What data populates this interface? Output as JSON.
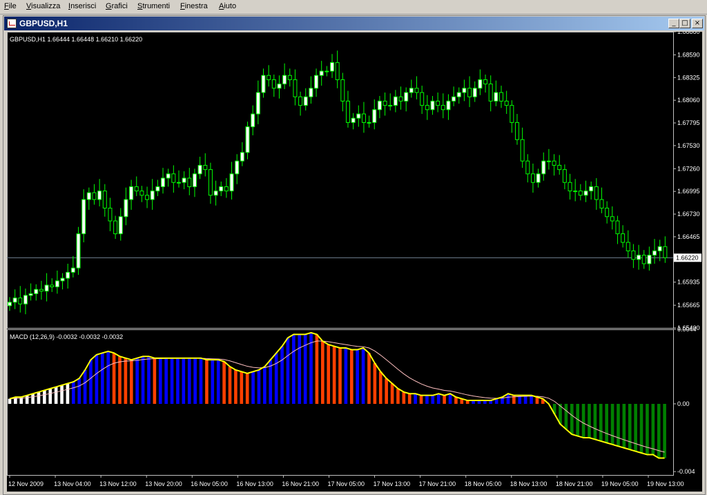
{
  "menu": [
    "File",
    "Visualizza",
    "Inserisci",
    "Grafici",
    "Strumenti",
    "Finestra",
    "Aiuto"
  ],
  "window": {
    "title": "GBPUSD,H1",
    "buttons": [
      "_",
      "□",
      "×"
    ]
  },
  "price_pane": {
    "label": "GBPUSD,H1  1.66444 1.66448 1.66210 1.66220",
    "price_ticks": [
      "1.68860",
      "1.68590",
      "1.68325",
      "1.68060",
      "1.67795",
      "1.67530",
      "1.67260",
      "1.66995",
      "1.66730",
      "1.66465",
      "1.66220",
      "1.65935",
      "1.65665",
      "1.65400"
    ],
    "current_price": "1.66220"
  },
  "macd_pane": {
    "label": "MACD (12,26,9) -0.0032 -0.0032 -0.0032",
    "ticks": [
      "0.0044",
      "0.00",
      "-0.004"
    ]
  },
  "time_ticks": [
    "12 Nov 2009",
    "13 Nov 04:00",
    "13 Nov 12:00",
    "13 Nov 20:00",
    "16 Nov 05:00",
    "16 Nov 13:00",
    "16 Nov 21:00",
    "17 Nov 05:00",
    "17 Nov 13:00",
    "17 Nov 21:00",
    "18 Nov 05:00",
    "18 Nov 13:00",
    "18 Nov 21:00",
    "19 Nov 05:00",
    "19 Nov 13:00"
  ],
  "colors": {
    "bull": "#ffffff",
    "bear": "#000000",
    "wick": "#00ff00",
    "grid": "#ffffff",
    "macd_up": "#0000ff",
    "macd_down": "#ff4000",
    "macd_neg_down": "#008000",
    "macd_line": "#ffff00",
    "signal_line": "#ffc0c0"
  },
  "chart_data": {
    "type": "candlestick",
    "symbol": "GBPUSD",
    "timeframe": "H1",
    "ylim": [
      1.654,
      1.6886
    ],
    "closes": [
      1.657,
      1.6575,
      1.6568,
      1.6578,
      1.658,
      1.6585,
      1.6583,
      1.659,
      1.6588,
      1.6595,
      1.6598,
      1.6605,
      1.661,
      1.665,
      1.669,
      1.6698,
      1.669,
      1.67,
      1.668,
      1.6665,
      1.665,
      1.667,
      1.669,
      1.6705,
      1.67,
      1.6695,
      1.669,
      1.67,
      1.6705,
      1.6715,
      1.672,
      1.671,
      1.671,
      1.6715,
      1.6705,
      1.672,
      1.673,
      1.6725,
      1.6695,
      1.67,
      1.6705,
      1.67,
      1.672,
      1.6735,
      1.6745,
      1.6775,
      1.679,
      1.6815,
      1.6835,
      1.683,
      1.682,
      1.6825,
      1.6835,
      1.683,
      1.681,
      1.68,
      1.681,
      1.682,
      1.6835,
      1.684,
      1.684,
      1.685,
      1.683,
      1.6805,
      1.678,
      1.6785,
      1.679,
      1.678,
      1.678,
      1.6795,
      1.6805,
      1.68,
      1.68,
      1.681,
      1.6805,
      1.6815,
      1.682,
      1.6815,
      1.68,
      1.6795,
      1.6805,
      1.68,
      1.6795,
      1.6805,
      1.681,
      1.6815,
      1.682,
      1.681,
      1.682,
      1.683,
      1.6825,
      1.6805,
      1.6815,
      1.6805,
      1.68,
      1.678,
      1.676,
      1.6735,
      1.672,
      1.671,
      1.672,
      1.6735,
      1.6735,
      1.673,
      1.6725,
      1.671,
      1.67,
      1.67,
      1.6695,
      1.67,
      1.6705,
      1.669,
      1.668,
      1.667,
      1.6665,
      1.665,
      1.664,
      1.663,
      1.662,
      1.6625,
      1.6615,
      1.6625,
      1.663,
      1.6635,
      1.6622
    ],
    "macd_hist": [
      0.0003,
      0.0004,
      0.0004,
      0.0005,
      0.0006,
      0.0007,
      0.0008,
      0.0009,
      0.001,
      0.0011,
      0.0012,
      0.0013,
      0.0015,
      0.002,
      0.0026,
      0.0029,
      0.003,
      0.0031,
      0.003,
      0.0028,
      0.0027,
      0.0026,
      0.0027,
      0.0028,
      0.0028,
      0.0027,
      0.0027,
      0.0027,
      0.0027,
      0.0027,
      0.0027,
      0.0027,
      0.0027,
      0.0027,
      0.0026,
      0.0026,
      0.0026,
      0.0025,
      0.0022,
      0.002,
      0.0019,
      0.0018,
      0.0019,
      0.002,
      0.0022,
      0.0026,
      0.003,
      0.0034,
      0.0039,
      0.0041,
      0.0041,
      0.0041,
      0.0042,
      0.0041,
      0.0037,
      0.0035,
      0.0034,
      0.0033,
      0.0033,
      0.0032,
      0.0032,
      0.0033,
      0.003,
      0.0024,
      0.0019,
      0.0015,
      0.0012,
      0.0009,
      0.0007,
      0.0006,
      0.0006,
      0.0005,
      0.0005,
      0.0005,
      0.0006,
      0.0005,
      0.0006,
      0.0004,
      0.0003,
      0.0002,
      0.0002,
      0.0002,
      0.0002,
      0.0002,
      0.0003,
      0.0004,
      0.0006,
      0.0005,
      0.0005,
      0.0005,
      0.0005,
      0.0004,
      0.0003,
      0.0,
      -0.0006,
      -0.0012,
      -0.0015,
      -0.0018,
      -0.0019,
      -0.002,
      -0.002,
      -0.0021,
      -0.0022,
      -0.0023,
      -0.0024,
      -0.0025,
      -0.0026,
      -0.0027,
      -0.0028,
      -0.0029,
      -0.003,
      -0.003,
      -0.0032,
      -0.0032
    ]
  }
}
